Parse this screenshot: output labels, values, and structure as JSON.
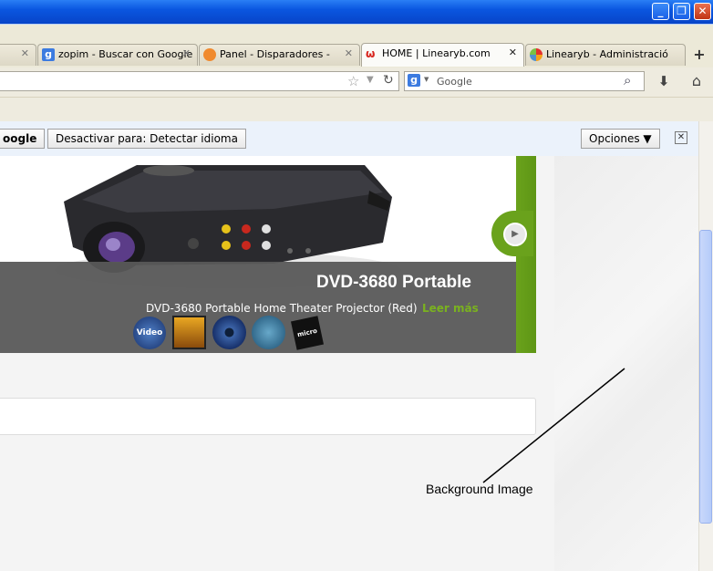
{
  "window": {
    "min_glyph": "_",
    "max_glyph": "❐",
    "close_glyph": "✕"
  },
  "tabs": [
    {
      "label": "",
      "icon": "blank-tab-icon",
      "active": false
    },
    {
      "label": "zopim - Buscar con Google",
      "icon": "google-icon",
      "active": false
    },
    {
      "label": "Panel - Disparadores -",
      "icon": "zopim-icon",
      "active": false
    },
    {
      "label": "HOME | Linearyb.com",
      "icon": "linearyb-icon",
      "active": true
    },
    {
      "label": "Linearyb - Administración ...",
      "icon": "joomla-icon",
      "active": false
    }
  ],
  "tab_close_glyph": "✕",
  "new_tab_glyph": "+",
  "nav": {
    "url_value": "",
    "search_placeholder": "Google",
    "search_engine_letter": "g"
  },
  "translate_bar": {
    "google_label": "oogle",
    "deactivate_label": "Desactivar para: Detectar idioma",
    "options_label": "Opciones ▼",
    "close_glyph": "✕"
  },
  "slider": {
    "title": "DVD-3680 Portable",
    "description": "DVD-3680 Portable Home Theater Projector (Red)",
    "read_more": "Leer más",
    "feature_icons": [
      "video-badge-icon",
      "picture-badge-icon",
      "dvd-disc-icon",
      "music-badge-icon",
      "micro-sd-icon"
    ],
    "video_badge_text": "Video",
    "sd_badge_text": "micro SD"
  },
  "annotation": {
    "text": "Background Image"
  },
  "colors": {
    "accent_green": "#7ab21f",
    "caption_bg": "#585858",
    "titlebar_blue": "#0a56e0"
  }
}
